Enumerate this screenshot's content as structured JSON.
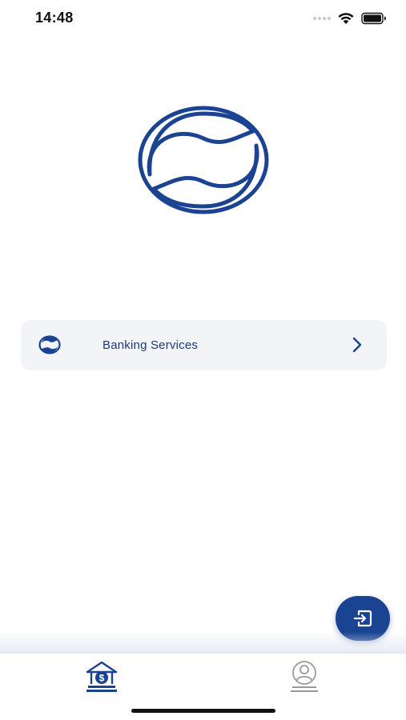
{
  "status_bar": {
    "time": "14:48",
    "signal_icon": "signal-dots-icon",
    "wifi_icon": "wifi-icon",
    "battery_icon": "battery-icon"
  },
  "brand": {
    "logo_icon": "bank-logo-icon",
    "color": "#1a4391"
  },
  "services": [
    {
      "label": "Banking Services",
      "icon": "bank-logo-icon",
      "chevron": "chevron-right-icon"
    }
  ],
  "fab": {
    "icon": "exit-login-icon",
    "color": "#1a4391"
  },
  "tab_bar": {
    "tabs": [
      {
        "name": "home",
        "icon": "bank-dollar-icon",
        "active": true
      },
      {
        "name": "profile",
        "icon": "user-profile-icon",
        "active": false
      }
    ]
  }
}
